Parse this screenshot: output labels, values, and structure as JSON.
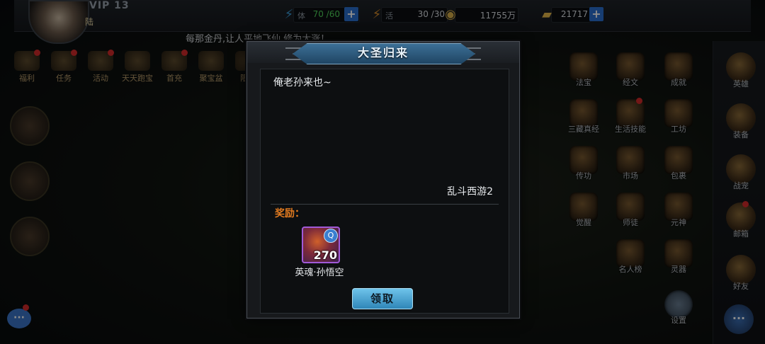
{
  "player": {
    "vip": "VIP 13",
    "name": "陆"
  },
  "resources": [
    {
      "label": "体",
      "value": "70 /60",
      "icon": "lightning-icon",
      "has_plus": true,
      "value_color": "#4fd35a"
    },
    {
      "label": "活",
      "value": "30 /30",
      "icon": "lightning-icon",
      "has_plus": false
    },
    {
      "label": "",
      "value": "11755万",
      "icon": "coin-icon",
      "has_plus": false
    },
    {
      "label": "",
      "value": "21717",
      "icon": "gold-ingot-icon",
      "has_plus": true
    }
  ],
  "marquee": "每那金丹,让人平地飞仙,修为大涨！",
  "left_menu": [
    "福利",
    "任务",
    "活动",
    "天天跑宝",
    "首充",
    "聚宝盆",
    "限时"
  ],
  "right_grid": [
    [
      "法宝",
      "经文",
      "成就"
    ],
    [
      "三藏真经",
      "生活技能",
      "工坊"
    ],
    [
      "传功",
      "市场",
      "包裹"
    ],
    [
      "觉醒",
      "师徒",
      "元神"
    ],
    [
      "",
      "名人榜",
      "灵器"
    ]
  ],
  "right_column": [
    "英雄",
    "装备",
    "战宠",
    "邮箱",
    "好友"
  ],
  "settings_label": "设置",
  "dialog": {
    "title": "大圣归来",
    "body": "俺老孙来也~",
    "signature": "乱斗西游2",
    "reward_label": "奖励：",
    "reward": {
      "name": "英魂·孙悟空",
      "count": "270"
    },
    "claim_button": "领取"
  },
  "colors": {
    "accent": "#2f86b8",
    "reward_label": "#e07a20",
    "item_border": "#a15ad8",
    "badge": "#d42a2a"
  }
}
